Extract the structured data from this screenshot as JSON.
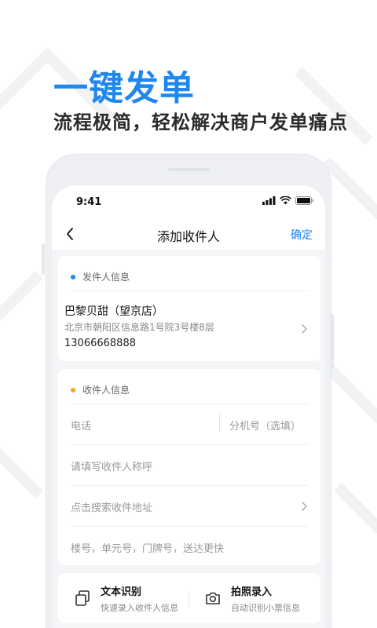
{
  "colors": {
    "accent": "#1e87f0",
    "sender_dot": "#1e87f0",
    "receiver_dot": "#f5a623"
  },
  "promo": {
    "headline": "一键发单",
    "subline": "流程极简，轻松解决商户发单痛点"
  },
  "status_bar": {
    "time": "9:41",
    "icons": [
      "signal-icon",
      "wifi-icon",
      "battery-icon"
    ]
  },
  "nav": {
    "back_icon": "chevron-left-icon",
    "title": "添加收件人",
    "confirm": "确定"
  },
  "sender": {
    "section_label": "发件人信息",
    "name": "巴黎贝甜（望京店）",
    "address": "北京市朝阳区信息路1号院3号楼8层",
    "phone": "13066668888"
  },
  "receiver": {
    "section_label": "收件人信息",
    "phone_placeholder": "电话",
    "extension_placeholder": "分机号（选填）",
    "name_placeholder": "请填写收件人称呼",
    "address_placeholder": "点击搜索收件地址",
    "detail_placeholder": "楼号，单元号，门牌号，送达更快"
  },
  "tools": [
    {
      "icon": "copy-text-icon",
      "title": "文本识别",
      "desc": "快速录入收件人信息"
    },
    {
      "icon": "camera-icon",
      "title": "拍照录入",
      "desc": "自动识别小票信息"
    }
  ]
}
